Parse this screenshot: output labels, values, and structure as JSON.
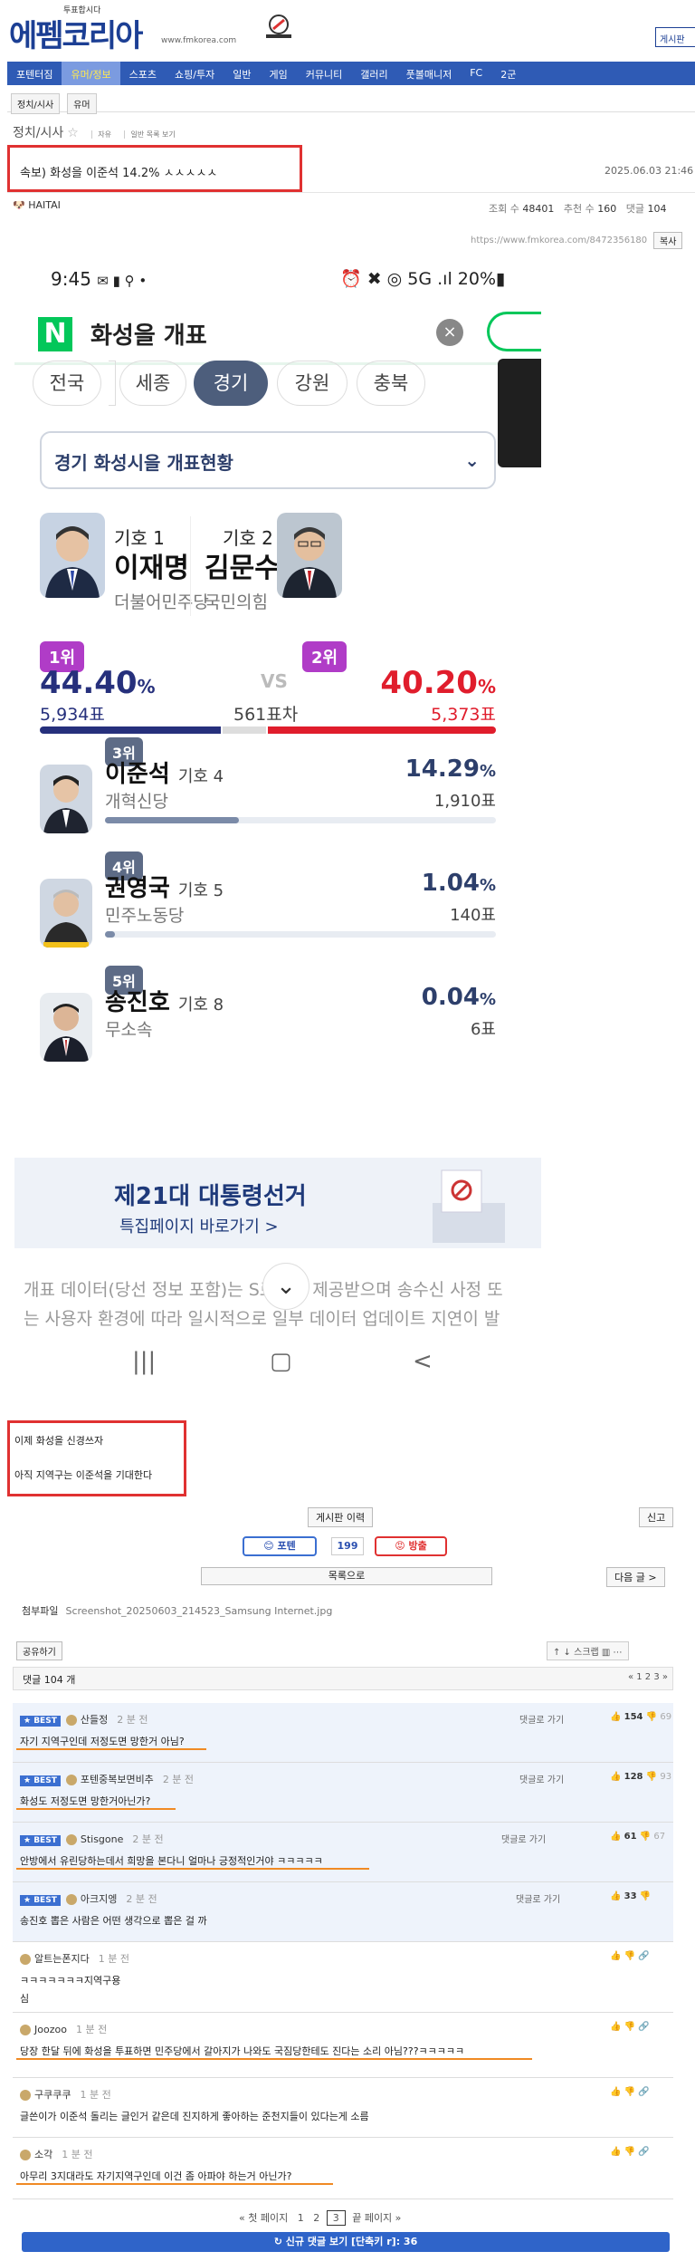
{
  "header": {
    "logo": "에펨코리아",
    "tagline": "투표합시다",
    "url": "www.fmkorea.com",
    "board_button": "게시판"
  },
  "nav": {
    "items": [
      "포텐터짐",
      "유머/정보",
      "스포츠",
      "쇼핑/투자",
      "일반",
      "게임",
      "커뮤니티",
      "갤러리",
      "풋볼매니저",
      "FC",
      "2군"
    ],
    "active": "유머/정보"
  },
  "subnav": [
    "정치/시사",
    "유머"
  ],
  "category": {
    "name": "정치/시사",
    "extra1": "자유",
    "extra2": "일반 목록 보기"
  },
  "post": {
    "title": "속보) 화성을 이준석 14.2% ㅅㅅㅅㅅㅅ",
    "date": "2025.06.03 21:46",
    "author": "HAITAI",
    "views_label": "조회 수",
    "views": "48401",
    "rec_label": "추천 수",
    "rec": "160",
    "comments_label": "댓글",
    "comments": "104",
    "url": "https://www.fmkorea.com/8472356180",
    "copy": "복사"
  },
  "phone": {
    "time": "9:45",
    "status_icons": "✉ ▮ ⚲ •",
    "battery": "⏰ ✖ ◎ 5G .ıl 20%▮",
    "search_query": "화성을 개표",
    "regions": [
      "전국",
      "세종",
      "경기",
      "강원",
      "충북"
    ],
    "active_region": "경기",
    "dropdown": "경기 화성시을 개표현황",
    "c1": {
      "rank": "1위",
      "num": "기호 1",
      "name": "이재명",
      "party": "더불어민주당",
      "pct": "44.40",
      "unit": "%",
      "votes": "5,934표"
    },
    "c2": {
      "rank": "2위",
      "num": "기호 2",
      "name": "김문수",
      "party": "국민의힘",
      "pct": "40.20",
      "unit": "%",
      "votes": "5,373표"
    },
    "vs": "VS",
    "gap": "561표차",
    "others": [
      {
        "rank": "3위",
        "name": "이준석",
        "num": "기호 4",
        "party": "개혁신당",
        "pct": "14.29",
        "unit": "%",
        "votes": "1,910표",
        "share": 0.143
      },
      {
        "rank": "4위",
        "name": "권영국",
        "num": "기호 5",
        "party": "민주노동당",
        "pct": "1.04",
        "unit": "%",
        "votes": "140표",
        "share": 0.0104
      },
      {
        "rank": "5위",
        "name": "송진호",
        "num": "기호 8",
        "party": "무소속",
        "pct": "0.04",
        "unit": "%",
        "votes": "6표",
        "share": 0.0004
      }
    ],
    "banner_title": "제21대 대통령선거",
    "banner_sub": "특집페이지 바로가기 >",
    "footer": "개표 데이터(당선 정보 포함)는 ​S로부터 제공받으며 송수신 사정 또는 사용자 환경에 따라 일시적으로 일부 데이터 업데이트 지연이 발생할 수 있습니다. 후보자 순위는 득표수에",
    "nav_keys": [
      "|||",
      "▢",
      "<"
    ]
  },
  "body_text": [
    "이제 화성을 신경쓰자",
    "아직 지역구는 이준석을 기대한다"
  ],
  "actions": {
    "history": "게시판 이력",
    "report": "신고",
    "vote_up": "포텐",
    "vote_count": "199",
    "vote_down": "방출",
    "list": "목록으로",
    "next": "다음 글 >"
  },
  "attachment": {
    "label": "첨부파일",
    "file": "Screenshot_20250603_214523_Samsung Internet.jpg"
  },
  "share": "공유하기",
  "tools": "↑ ↓ 스크랩 ▥ ⋯",
  "comment_count": "댓글 104 개",
  "pager_top": "« 1 2 3 »",
  "comments": [
    {
      "best": true,
      "user": "산들정",
      "time": "2 분 전",
      "reply": "댓글로 가기",
      "likes": "154",
      "dis": "69",
      "text": "자기 지역구인데 저정도면 망한거 아님?"
    },
    {
      "best": true,
      "user": "포텐중복보면비추",
      "time": "2 분 전",
      "reply": "댓글로 가기",
      "likes": "128",
      "dis": "93",
      "text": "화성도 저정도면 망한거아닌가?"
    },
    {
      "best": true,
      "user": "Stisgone",
      "time": "2 분 전",
      "reply": "댓글로 가기",
      "likes": "61",
      "dis": "67",
      "text": "안방에서 유린당하는데서 희망을 본다니 얼마나 긍정적인거야 ㅋㅋㅋㅋㅋ"
    },
    {
      "best": true,
      "user": "아크지엥",
      "time": "2 분 전",
      "reply": "댓글로 가기",
      "likes": "33",
      "dis": "",
      "text": "송진호 뽑은 사람은 어떤 생각으로 뽑은 걸 까"
    },
    {
      "best": false,
      "user": "알트는폰지다",
      "time": "1 분 전",
      "text": "ㅋㅋㅋㅋㅋㅋㅋ지역구용",
      "text2": "심"
    },
    {
      "best": false,
      "user": "Joozoo",
      "time": "1 분 전",
      "text": "당장 한달 뒤에 화성을 투표하면 민주당에서 갈아지가 나와도 국짐당한테도 진다는 소리 아님???ㅋㅋㅋㅋㅋ"
    },
    {
      "best": false,
      "user": "구쿠쿠쿠",
      "time": "1 분 전",
      "text": "글쓴이가 이준석 돌리는 글인거 같은데 진지하게 좋아하는 준천지들이 있다는게 소름"
    },
    {
      "best": false,
      "user": "소각",
      "time": "1 분 전",
      "text": "아무리 3지대라도 자기지역구인데 이건 좀 아파야 하는거 아닌가?"
    }
  ],
  "pager_bottom": {
    "first": "« 첫 페이지",
    "pages": [
      "1",
      "2",
      "3"
    ],
    "current": "3",
    "last": "끝 페이지 »"
  },
  "new_comments": "↻ 신규 댓글 보기 [단축키 r]: 36"
}
